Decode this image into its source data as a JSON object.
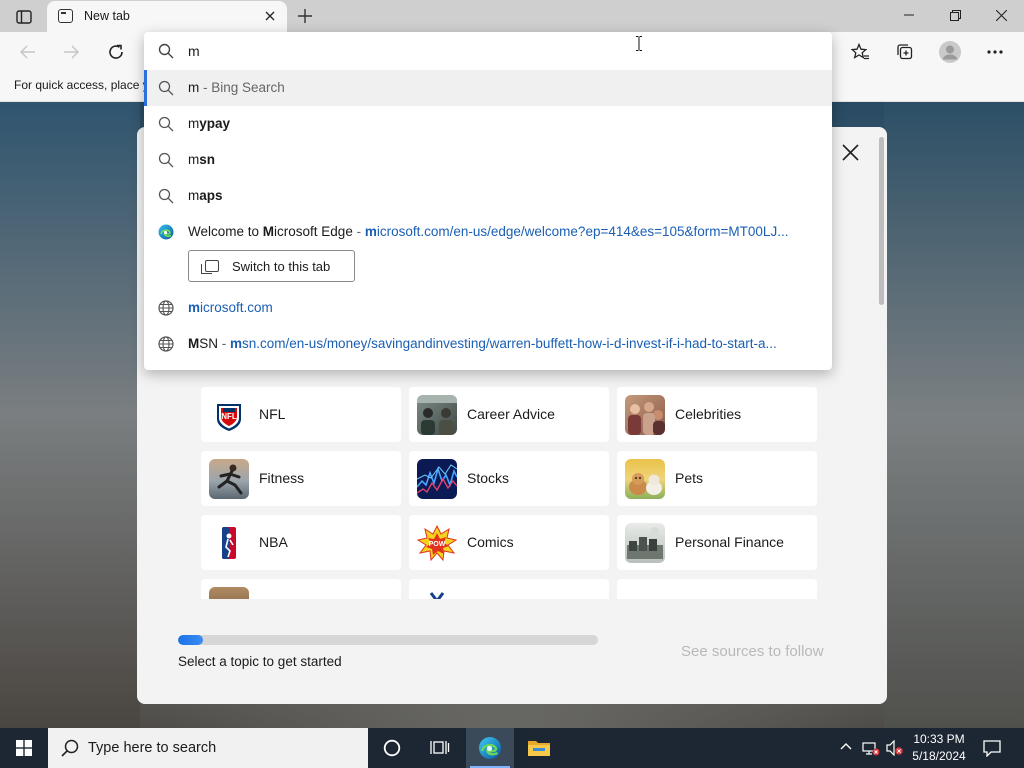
{
  "browser": {
    "tab": {
      "title": "New tab"
    },
    "favorites_bar": {
      "message": "For quick access, place y"
    }
  },
  "omnibox": {
    "query": "m",
    "suggestions": [
      {
        "type": "search",
        "typed": "m",
        "rest": "",
        "suffix": " - Bing Search",
        "icon": "search-icon"
      },
      {
        "type": "search",
        "typed": "m",
        "rest": "ypay",
        "icon": "search-icon"
      },
      {
        "type": "search",
        "typed": "m",
        "rest": "sn",
        "icon": "search-icon"
      },
      {
        "type": "search",
        "typed": "m",
        "rest": "aps",
        "icon": "search-icon"
      },
      {
        "type": "tab",
        "title_pre": "Welcome to ",
        "title_match": "M",
        "title_post": "icrosoft Edge",
        "sep": " - ",
        "url_match": "m",
        "url_rest": "icrosoft.com/en-us/edge/welcome?ep=414&es=105&form=MT00LJ...",
        "icon": "edge-icon"
      },
      {
        "type": "site",
        "url_match": "m",
        "url_rest": "icrosoft.com",
        "icon": "globe-icon"
      },
      {
        "type": "site",
        "title_match": "M",
        "title_post": "SN",
        "sep": " - ",
        "url_match": "m",
        "url_rest": "sn.com/en-us/money/savingandinvesting/warren-buffett-how-i-d-invest-if-i-had-to-start-a...",
        "icon": "globe-icon"
      }
    ],
    "switch_tab_label": "Switch to this tab"
  },
  "topics": [
    {
      "label": "NFL",
      "icon": "nfl-logo"
    },
    {
      "label": "Career Advice",
      "icon": "career-advice-photo"
    },
    {
      "label": "Celebrities",
      "icon": "celebrities-photo"
    },
    {
      "label": "Fitness",
      "icon": "fitness-photo"
    },
    {
      "label": "Stocks",
      "icon": "stocks-photo"
    },
    {
      "label": "Pets",
      "icon": "pets-photo"
    },
    {
      "label": "NBA",
      "icon": "nba-logo"
    },
    {
      "label": "Comics",
      "icon": "comics-photo"
    },
    {
      "label": "Personal Finance",
      "icon": "personal-finance-photo"
    }
  ],
  "onboarding": {
    "progress_text": "Select a topic to get started",
    "progress_fraction": 0.06,
    "see_sources": "See sources to follow"
  },
  "taskbar": {
    "search_placeholder": "Type here to search",
    "time": "10:33 PM",
    "date": "5/18/2024"
  },
  "colors": {
    "accent": "#1a73e8",
    "url_link": "#1a5fb4",
    "taskbar": "#1c2733"
  }
}
